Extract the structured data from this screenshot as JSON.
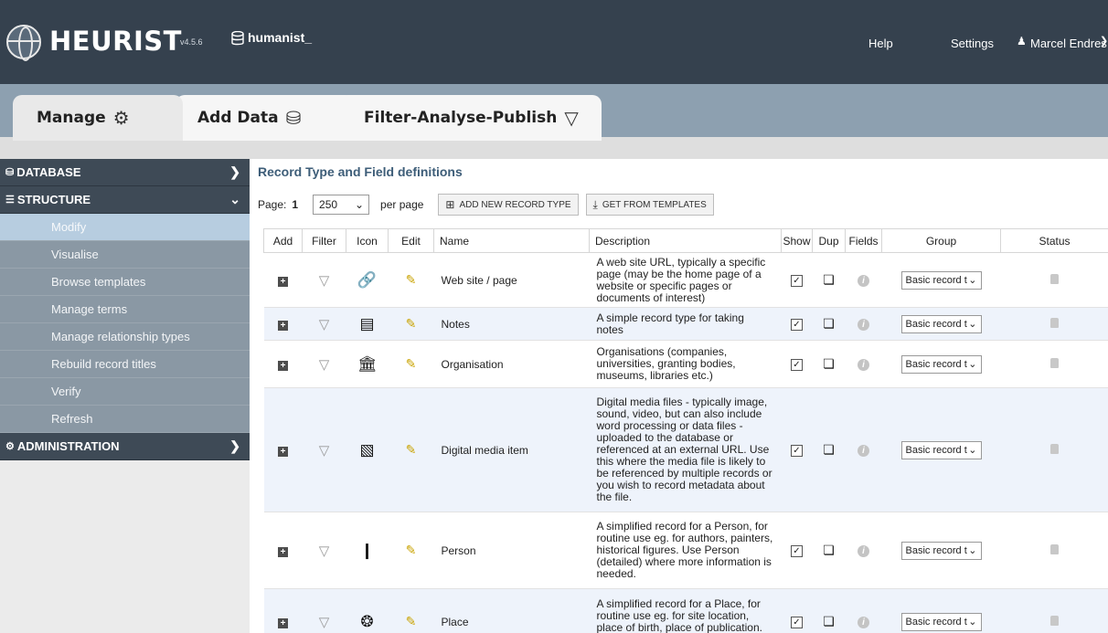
{
  "header": {
    "logo_text": "HEURIST",
    "version": "v4.5.6",
    "db_name": "humanist_",
    "nav": {
      "help": "Help",
      "settings": "Settings",
      "user": "Marcel Endres"
    }
  },
  "tabs": [
    {
      "label": "Manage",
      "icon": "gears-icon"
    },
    {
      "label": "Add Data",
      "icon": "database-add-icon"
    },
    {
      "label": "Filter-Analyse-Publish",
      "icon": "filter-icon"
    }
  ],
  "sidebar": {
    "sections": {
      "database": "DATABASE",
      "structure": "STRUCTURE",
      "administration": "ADMINISTRATION"
    },
    "items": [
      {
        "label": "Modify"
      },
      {
        "label": "Visualise"
      },
      {
        "label": "Browse templates"
      },
      {
        "label": "Manage terms"
      },
      {
        "label": "Manage relationship types"
      },
      {
        "label": "Rebuild record titles"
      },
      {
        "label": "Verify"
      },
      {
        "label": "Refresh"
      }
    ]
  },
  "main": {
    "title": "Record Type and Field definitions",
    "page_label": "Page:",
    "page_num": "1",
    "per_page_value": "250",
    "per_page_label": "per page",
    "add_button": "ADD NEW RECORD TYPE",
    "templates_button": "GET FROM TEMPLATES"
  },
  "table": {
    "headers": [
      "Add",
      "Filter",
      "Icon",
      "Edit",
      "Name",
      "Description",
      "Show",
      "Dup",
      "Fields",
      "Group",
      "Status"
    ],
    "group_value": "Basic record t",
    "rows": [
      {
        "name": "Web site / page",
        "desc": "A web site URL, typically a specific page (may be the home page of a website or specific pages or documents of interest)",
        "icon": "link-icon"
      },
      {
        "name": "Notes",
        "desc": "A simple record type for taking notes",
        "icon": "notepad-icon"
      },
      {
        "name": "Organisation",
        "desc": "Organisations (companies, universities, granting bodies, museums, libraries etc.)",
        "icon": "institution-icon"
      },
      {
        "name": "Digital media item",
        "desc": "Digital media files - typically image, sound, video, but can also include word processing or data files - uploaded to the database or referenced at an external URL. Use this where the media file is likely to be referenced by multiple records or you wish to record metadata about the file.",
        "icon": "media-files-icon"
      },
      {
        "name": "Person",
        "desc": "A simplified record for a Person, for routine use eg. for authors, painters, historical figures. Use Person (detailed) where more information is needed.",
        "icon": "person-icon"
      },
      {
        "name": "Place",
        "desc": "A simplified record for a Place, for routine use eg. for site location, place of birth, place of publication. Use",
        "icon": "place-icon"
      }
    ]
  }
}
